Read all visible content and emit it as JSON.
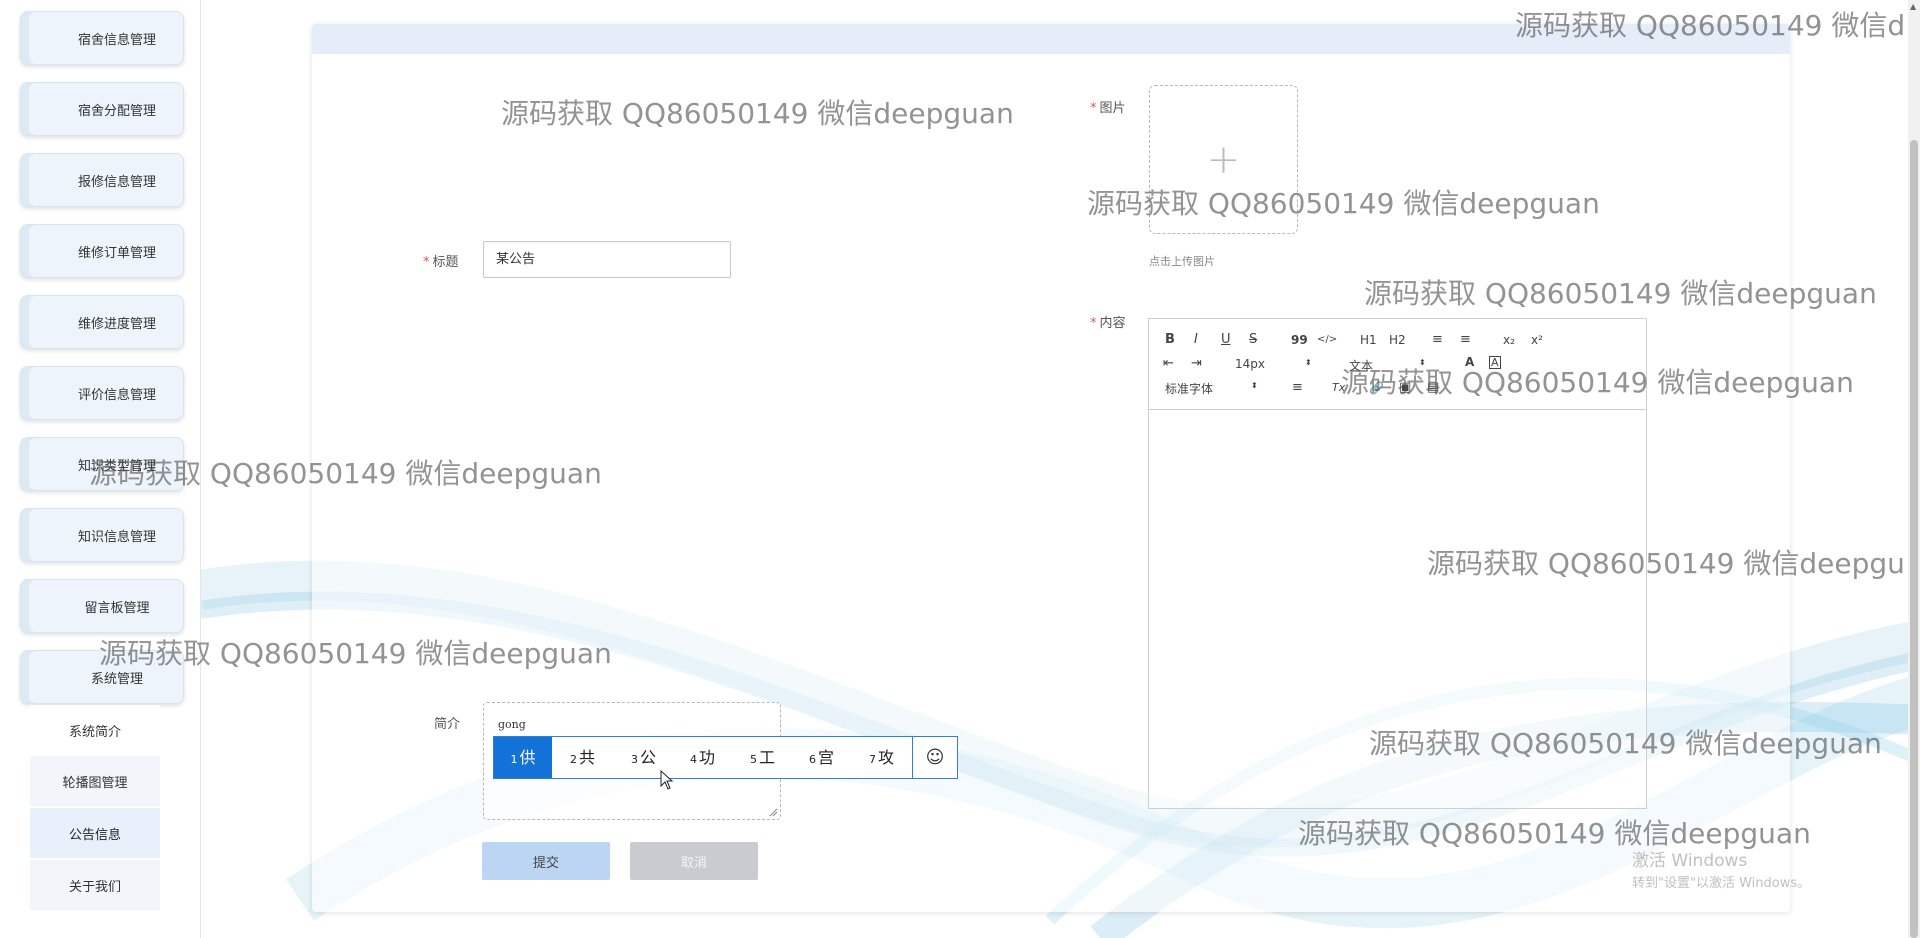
{
  "sidebar": {
    "items": [
      {
        "label": "宿舍信息管理"
      },
      {
        "label": "宿舍分配管理"
      },
      {
        "label": "报修信息管理"
      },
      {
        "label": "维修订单管理"
      },
      {
        "label": "维修进度管理"
      },
      {
        "label": "评价信息管理"
      },
      {
        "label": "知识类型管理"
      },
      {
        "label": "知识信息管理"
      },
      {
        "label": "留言板管理"
      },
      {
        "label": "系统管理"
      }
    ],
    "sub_items": [
      {
        "label": "系统简介"
      },
      {
        "label": "轮播图管理"
      },
      {
        "label": "公告信息"
      },
      {
        "label": "关于我们"
      }
    ]
  },
  "form": {
    "title_label": "标题",
    "title_value": "某公告",
    "image_label": "图片",
    "upload_plus": "+",
    "upload_tip": "点击上传图片",
    "content_label": "内容",
    "intro_label": "简介",
    "intro_value": "gong",
    "required_mark": "*"
  },
  "editor": {
    "toolbar": {
      "bold": "B",
      "italic": "I",
      "underline": "U",
      "strike": "S",
      "quote": "99",
      "code": "</>",
      "h1": "H1",
      "h2": "H2",
      "ordered_list": "≡",
      "bullet_list": "≡",
      "subscript": "x₂",
      "superscript": "x²",
      "outdent": "⇤",
      "indent": "⇥",
      "size_value": "14px",
      "text_style_value": "文本",
      "color": "A",
      "background": "A",
      "font_value": "标准字体",
      "align": "≡",
      "clean": "Tx",
      "link": "🔗",
      "image": "▣",
      "video": "▤",
      "select_arrow": "⬍"
    }
  },
  "ime": {
    "candidates": [
      {
        "num": "1",
        "char": "供"
      },
      {
        "num": "2",
        "char": "共"
      },
      {
        "num": "3",
        "char": "公"
      },
      {
        "num": "4",
        "char": "功"
      },
      {
        "num": "5",
        "char": "工"
      },
      {
        "num": "6",
        "char": "宫"
      },
      {
        "num": "7",
        "char": "攻"
      }
    ],
    "emoji": "☺"
  },
  "buttons": {
    "submit": "提交",
    "cancel": "取消"
  },
  "watermark": {
    "text": "源码获取 QQ86050149 微信deepguan",
    "text_cut1": "源码获取 QQ86050149 微信d",
    "text_cut2": "源码获取 QQ86050149 微信deepgu"
  },
  "windows_activation": {
    "line1": "激活 Windows",
    "line2": "转到\"设置\"以激活 Windows。"
  },
  "colors": {
    "accent": "#1372d8",
    "required": "#e05656",
    "submit_bg": "#bcd5f3",
    "cancel_bg": "#c8cbd0"
  }
}
